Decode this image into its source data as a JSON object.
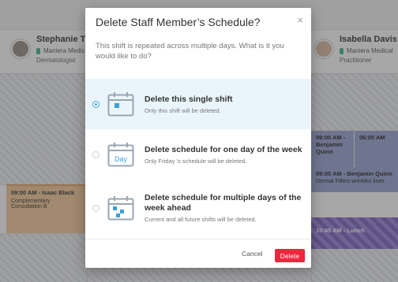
{
  "modal": {
    "title": "Delete Staff Member’s Schedule?",
    "close_glyph": "×",
    "description": "This shift is repeated across multiple days. What is it you would like to do?",
    "options": [
      {
        "title": "Delete this single shift",
        "subtitle": "Only this shift will be deleted.",
        "selected": true,
        "icon": "calendar-single-day-icon"
      },
      {
        "title": "Delete schedule for one day of the week",
        "subtitle": "Only Friday ’s schedule will be deleted.",
        "selected": false,
        "icon": "calendar-weekday-icon",
        "icon_label": "Day"
      },
      {
        "title": "Delete schedule for multiple days of the week ahead",
        "subtitle": "Current and all future shifts will be deleted.",
        "selected": false,
        "icon": "calendar-multiple-days-icon"
      }
    ],
    "cancel_label": "Cancel",
    "delete_label": "Delete"
  },
  "background": {
    "staff": [
      {
        "name": "Stephanie T.",
        "location": "Maniera Medical",
        "role": "Dermatologist"
      },
      {
        "name": "Isabella Davis",
        "location": "Maniera Medical",
        "role": "Practitioner"
      }
    ],
    "appointments": [
      {
        "time_name": "09:00 AM - Isaac Black",
        "desc": "Complementary Consultation B"
      },
      {
        "time_name": "09:00 AM - Benjamin Quinn",
        "desc": ""
      },
      {
        "time_name": "06:00 AM",
        "desc": ""
      },
      {
        "time_name": "09:00 AM - Benjamin Quinn",
        "desc": "Dermal Fillers wrinkles lines"
      },
      {
        "time_name": "10:45 AM - Lunch",
        "desc": ""
      }
    ]
  },
  "colors": {
    "accent": "#3ba0d8",
    "danger": "#e8283c",
    "selected_bg": "#eaf5fb"
  }
}
